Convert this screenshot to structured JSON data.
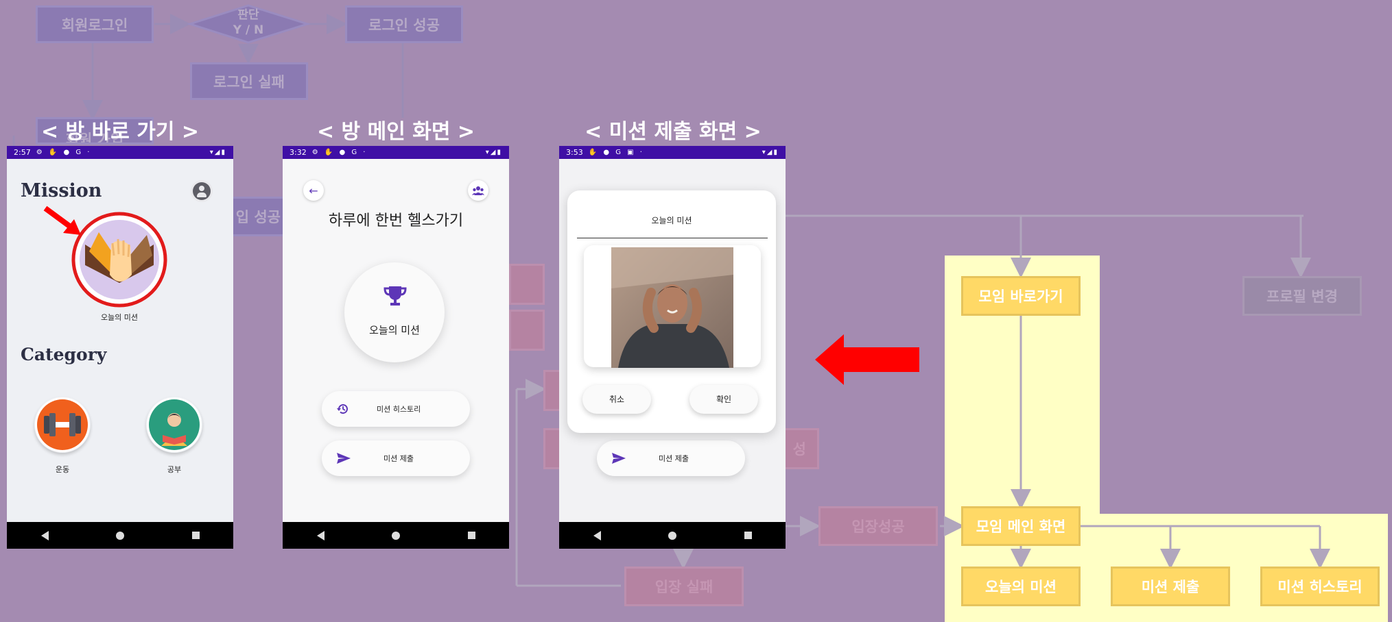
{
  "titles": {
    "room_shortcut": "< 방 바로 가기 >",
    "room_main": "< 방 메인 화면 >",
    "mission_submit": "< 미션 제출 화면 >"
  },
  "flowchart": {
    "member_login": "회원로그인",
    "decision": "판단",
    "decision_yn": "Y / N",
    "login_success": "로그인 성공",
    "login_fail": "로그인 실패",
    "signup_partial": "회원 가입",
    "signup_success_partial": "입 성공",
    "entry_success": "입장성공",
    "entry_fail": "입장 실패",
    "hidden_partial": "성",
    "group_shortcut": "모임 바로가기",
    "profile_change": "프로필 변경",
    "group_main": "모임 메인 화면",
    "todays_mission": "오늘의 미션",
    "mission_submit": "미션 제출",
    "mission_history": "미션 히스토리"
  },
  "phone1": {
    "time": "2:57",
    "heading_mission": "Mission",
    "mission_label": "오늘의 미션",
    "heading_category": "Category",
    "cat_exercise": "운동",
    "cat_study": "공부",
    "profile_icon": "account-circle-icon"
  },
  "phone2": {
    "time": "3:32",
    "room_title": "하루에 한번 헬스가기",
    "todays_mission": "오늘의 미션",
    "history_btn": "미션 히스토리",
    "submit_btn": "미션 제출",
    "back_icon": "arrow-back-icon",
    "group_icon": "group-icon"
  },
  "phone3": {
    "time": "3:53",
    "dialog_title": "오늘의 미션",
    "cancel_btn": "취소",
    "confirm_btn": "확인",
    "submit_btn": "미션 제출"
  },
  "colors": {
    "background": "#a48bb1",
    "status_bar": "#3f0fa5",
    "accent": "#5d36b7",
    "highlight_red": "#ff0000",
    "yellow_panel": "#ffffc5",
    "yellow_box": "#ffd966"
  }
}
